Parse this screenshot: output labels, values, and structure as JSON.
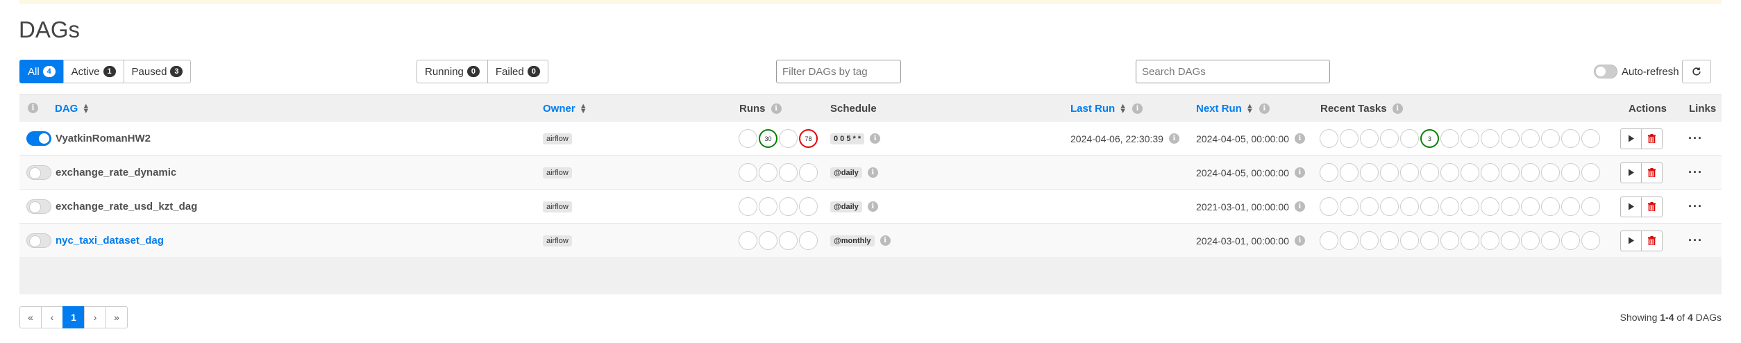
{
  "page": {
    "title": "DAGs"
  },
  "status_filters": [
    {
      "label": "All",
      "count": "4",
      "active": true
    },
    {
      "label": "Active",
      "count": "1",
      "active": false
    },
    {
      "label": "Paused",
      "count": "3",
      "active": false
    }
  ],
  "run_filters": [
    {
      "label": "Running",
      "count": "0"
    },
    {
      "label": "Failed",
      "count": "0"
    }
  ],
  "tag_filter": {
    "placeholder": "Filter DAGs by tag"
  },
  "search": {
    "placeholder": "Search DAGs"
  },
  "auto_refresh": {
    "label": "Auto-refresh"
  },
  "columns": {
    "dag": "DAG",
    "owner": "Owner",
    "runs": "Runs",
    "schedule": "Schedule",
    "last_run": "Last Run",
    "next_run": "Next Run",
    "recent_tasks": "Recent Tasks",
    "actions": "Actions",
    "links": "Links"
  },
  "dags": [
    {
      "name": "VyatkinRomanHW2",
      "paused": false,
      "owner": "airflow",
      "runs": [
        "",
        "30",
        "",
        "78"
      ],
      "run_states": [
        "",
        "success",
        "",
        "failed"
      ],
      "schedule": "0 0 5 * *",
      "last_run": "2024-04-06, 22:30:39",
      "next_run": "2024-04-05, 00:00:00",
      "recent_task_counts": {
        "success": "3"
      }
    },
    {
      "name": "exchange_rate_dynamic",
      "paused": true,
      "owner": "airflow",
      "runs": [
        "",
        "",
        "",
        ""
      ],
      "run_states": [
        "",
        "",
        "",
        ""
      ],
      "schedule": "@daily",
      "last_run": "",
      "next_run": "2024-04-05, 00:00:00",
      "recent_task_counts": {}
    },
    {
      "name": "exchange_rate_usd_kzt_dag",
      "paused": true,
      "owner": "airflow",
      "runs": [
        "",
        "",
        "",
        ""
      ],
      "run_states": [
        "",
        "",
        "",
        ""
      ],
      "schedule": "@daily",
      "last_run": "",
      "next_run": "2021-03-01, 00:00:00",
      "recent_task_counts": {}
    },
    {
      "name": "nyc_taxi_dataset_dag",
      "paused": true,
      "owner": "airflow",
      "runs": [
        "",
        "",
        "",
        ""
      ],
      "run_states": [
        "",
        "",
        "",
        ""
      ],
      "schedule": "@monthly",
      "last_run": "",
      "next_run": "2024-03-01, 00:00:00",
      "recent_task_counts": {}
    }
  ],
  "pagination": {
    "first": "«",
    "prev": "‹",
    "current": "1",
    "next": "›",
    "last": "»"
  },
  "showing": {
    "prefix": "Showing ",
    "range": "1-4",
    "of": " of ",
    "total": "4",
    "suffix": " DAGs"
  },
  "colors": {
    "accent": "#017cee",
    "success": "#008000",
    "failed": "#e00000"
  },
  "icons": {
    "refresh": "refresh-icon",
    "trigger": "play-icon",
    "delete": "trash-icon",
    "links": "more-icon",
    "info": "info-icon"
  }
}
